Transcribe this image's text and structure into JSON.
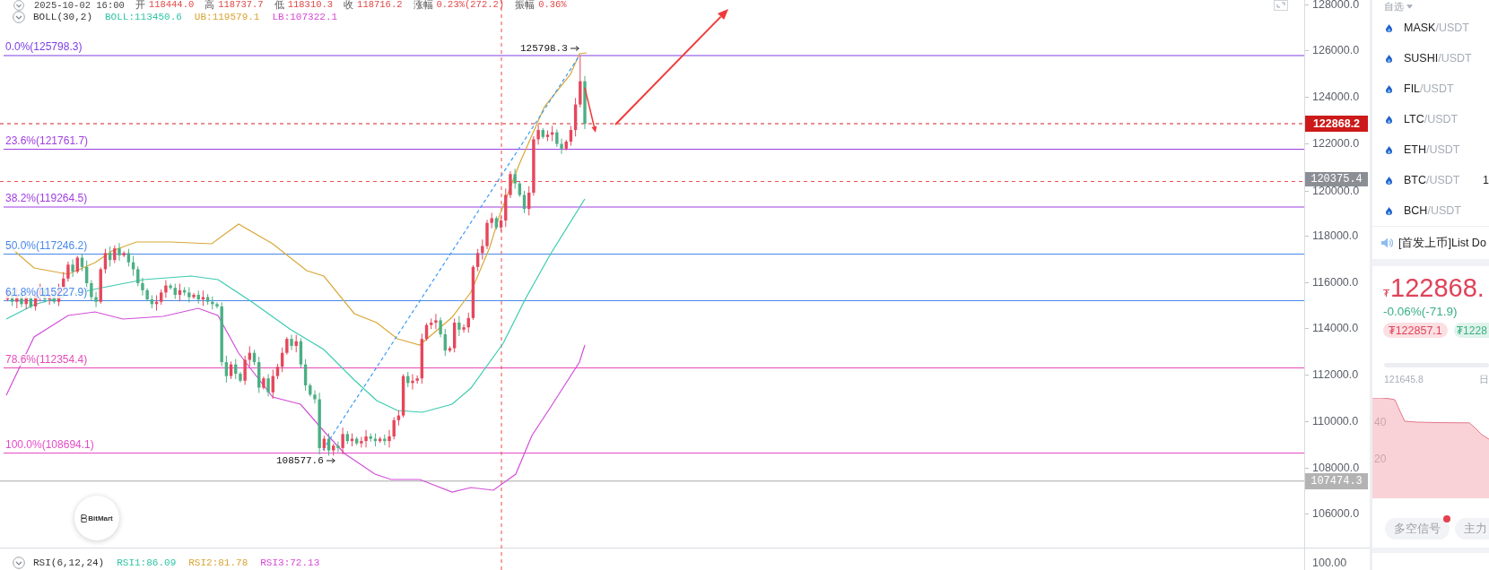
{
  "legend": {
    "bar_time": "2025-10-02 16:00",
    "bar_fields": [
      {
        "label": "开",
        "value": "118444.0"
      },
      {
        "label": "高",
        "value": "118737.7"
      },
      {
        "label": "低",
        "value": "118310.3"
      },
      {
        "label": "收",
        "value": "118716.2"
      },
      {
        "label": "涨幅",
        "value": "0.23%(272.2)"
      },
      {
        "label": "振幅",
        "value": "0.36%"
      }
    ],
    "indicator": "BOLL(30,2)",
    "indicator_values": [
      {
        "text": "BOLL:113450.6",
        "color": "#2ec4a4"
      },
      {
        "text": "UB:119579.1",
        "color": "#d9a433"
      },
      {
        "text": "LB:107322.1",
        "color": "#d946d9"
      }
    ]
  },
  "fib_levels": [
    {
      "label": "0.0%(125798.3)",
      "color": "#7c3fe4"
    },
    {
      "label": "23.6%(121761.7)",
      "color": "#a03ee0"
    },
    {
      "label": "38.2%(119264.5)",
      "color": "#a03ee0"
    },
    {
      "label": "50.0%(117246.2)",
      "color": "#4a88ec"
    },
    {
      "label": "61.8%(115227.9)",
      "color": "#4a88ec"
    },
    {
      "label": "78.6%(112354.4)",
      "color": "#e44bb8"
    },
    {
      "label": "100.0%(108694.1)",
      "color": "#e44bc8"
    }
  ],
  "annotations": [
    {
      "kind": "high",
      "text": "125798.3"
    },
    {
      "kind": "low",
      "text": "108577.6"
    }
  ],
  "price_axis": {
    "ticks": [
      "128000.0",
      "126000.0",
      "124000.0",
      "122000.0",
      "120000.0",
      "118000.0",
      "116000.0",
      "114000.0",
      "112000.0",
      "110000.0",
      "108000.0",
      "106000.0"
    ],
    "markers": [
      {
        "text": "122868.2",
        "kind": "last"
      },
      {
        "text": "120375.4",
        "kind": "cursor"
      },
      {
        "text": "107474.3",
        "kind": "level"
      }
    ]
  },
  "logo": "BitMart",
  "rsi": {
    "indicator": "RSI(6,12,24)",
    "values": [
      {
        "text": "RSI1:86.09",
        "color": "#2ec4a4"
      },
      {
        "text": "RSI2:81.78",
        "color": "#d9a433"
      },
      {
        "text": "RSI3:72.13",
        "color": "#d946d9"
      }
    ],
    "tick": "100.00"
  },
  "sidebar": {
    "watchlist_title": "自选",
    "watchlist": [
      {
        "base": "MASK",
        "quote": "/USDT"
      },
      {
        "base": "SUSHI",
        "quote": "/USDT"
      },
      {
        "base": "FIL",
        "quote": "/USDT"
      },
      {
        "base": "LTC",
        "quote": "/USDT"
      },
      {
        "base": "ETH",
        "quote": "/USDT"
      },
      {
        "base": "BTC",
        "quote": "/USDT",
        "price": "1"
      },
      {
        "base": "BCH",
        "quote": "/USDT"
      }
    ],
    "announcement": "[首发上币]List Do",
    "ticker": {
      "currency": "₮",
      "price": "122868.",
      "change": "-0.06%(-71.9)",
      "bid": "₮122857.1",
      "ask": "₮1228"
    },
    "depth": {
      "low_label": "121645.8",
      "right_label": "日",
      "scale_labels": [
        "40",
        "20"
      ]
    },
    "tabs": [
      {
        "label": "多空信号",
        "selected": false,
        "dot": true
      },
      {
        "label": "主力",
        "selected": false,
        "dot": false
      }
    ]
  }
}
